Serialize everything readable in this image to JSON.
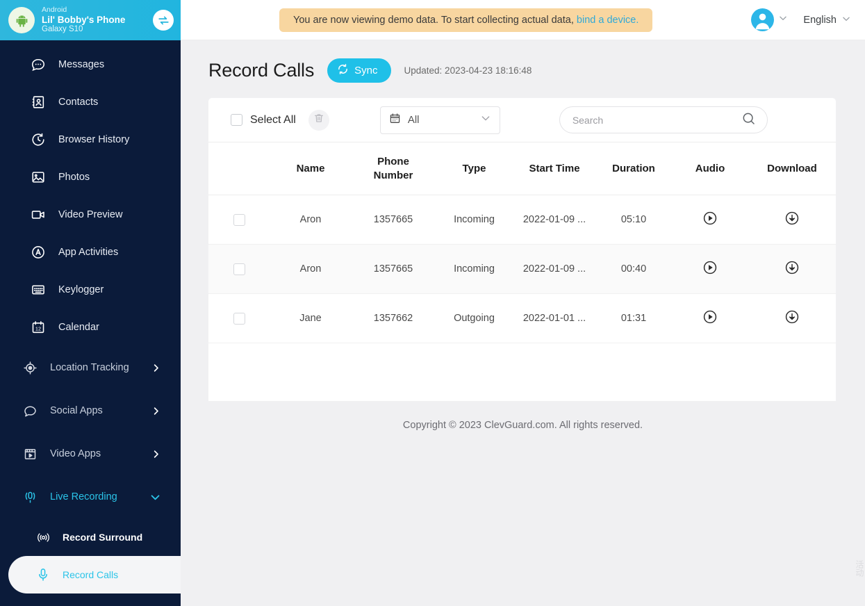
{
  "device": {
    "os": "Android",
    "name": "Lil' Bobby's Phone",
    "model": "Galaxy S10",
    "android_icon": "android-robot-icon",
    "switch_icon": "switch-device-icon"
  },
  "sidebar": {
    "items": [
      {
        "label": "Messages",
        "icon": "message-bubble-icon"
      },
      {
        "label": "Contacts",
        "icon": "contacts-card-icon"
      },
      {
        "label": "Browser History",
        "icon": "clock-history-icon"
      },
      {
        "label": "Photos",
        "icon": "photo-icon"
      },
      {
        "label": "Video Preview",
        "icon": "video-camera-icon"
      },
      {
        "label": "App Activities",
        "icon": "app-activities-icon"
      },
      {
        "label": "Keylogger",
        "icon": "keyboard-icon"
      },
      {
        "label": "Calendar",
        "icon": "calendar-icon"
      }
    ],
    "groups": [
      {
        "label": "Location Tracking",
        "icon": "location-target-icon",
        "expanded": false
      },
      {
        "label": "Social Apps",
        "icon": "chat-bubble-icon",
        "expanded": false
      },
      {
        "label": "Video Apps",
        "icon": "film-play-icon",
        "expanded": false
      },
      {
        "label": "Live Recording",
        "icon": "mic-waves-icon",
        "expanded": true
      }
    ],
    "subitems": [
      {
        "label": "Record Surround",
        "icon": "surround-record-icon",
        "active": false
      },
      {
        "label": "Record Calls",
        "icon": "microphone-icon",
        "active": true
      }
    ]
  },
  "topbar": {
    "banner_text": "You are now viewing demo data. To start collecting actual data,",
    "banner_link": "bind a device.",
    "language": "English",
    "avatar_icon": "user-avatar-icon",
    "chevron_icon": "chevron-down-icon"
  },
  "page": {
    "title": "Record Calls",
    "sync_label": "Sync",
    "sync_icon": "refresh-icon",
    "updated_label": "Updated: 2023-04-23 18:16:48"
  },
  "toolbar": {
    "select_all_label": "Select All",
    "delete_icon": "trash-icon",
    "filter_icon": "calendar-icon",
    "filter_value": "All",
    "search_placeholder": "Search",
    "search_value": "",
    "search_icon": "search-icon"
  },
  "table": {
    "headers": [
      "Name",
      "Phone\nNumber",
      "Type",
      "Start Time",
      "Duration",
      "Audio",
      "Download"
    ],
    "headers_flat": {
      "name": "Name",
      "phone_line1": "Phone",
      "phone_line2": "Number",
      "type": "Type",
      "start_time": "Start Time",
      "duration": "Duration",
      "audio": "Audio",
      "download": "Download"
    },
    "rows": [
      {
        "name": "Aron",
        "phone": "1357665",
        "type": "Incoming",
        "start_time": "2022-01-09 ...",
        "duration": "05:10",
        "audio_icon": "play-icon",
        "download_icon": "download-icon"
      },
      {
        "name": "Aron",
        "phone": "1357665",
        "type": "Incoming",
        "start_time": "2022-01-09 ...",
        "duration": "00:40",
        "audio_icon": "play-icon",
        "download_icon": "download-icon"
      },
      {
        "name": "Jane",
        "phone": "1357662",
        "type": "Outgoing",
        "start_time": "2022-01-01 ...",
        "duration": "01:31",
        "audio_icon": "play-icon",
        "download_icon": "download-icon"
      }
    ]
  },
  "footer": {
    "text": "Copyright © 2023 ClevGuard.com. All rights reserved."
  },
  "side_tab": {
    "text": "活动"
  },
  "colors": {
    "sidebar_bg": "#0b1b3a",
    "accent_teal": "#1fc0e8",
    "header_teal": "#29b7dd",
    "banner_bg": "#f8d6a0",
    "page_bg": "#f0f0f2"
  }
}
